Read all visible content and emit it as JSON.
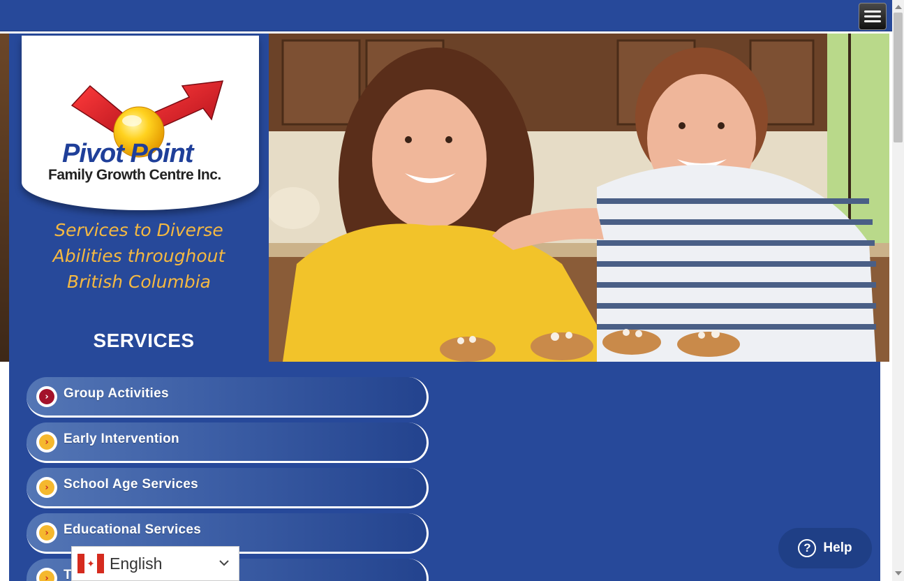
{
  "header": {
    "menu_icon": "hamburger-menu-icon"
  },
  "logo": {
    "name": "Pivot Point",
    "subtitle": "Family Growth Centre Inc."
  },
  "tagline": {
    "line1": "Services to Diverse",
    "line2": "Abilities throughout",
    "line3": "British Columbia"
  },
  "services": {
    "title": "SERVICES",
    "items": [
      {
        "label": "Group Activities",
        "active": true
      },
      {
        "label": "Early Intervention",
        "active": false
      },
      {
        "label": "School Age Services",
        "active": false
      },
      {
        "label": "Educational Services",
        "active": false
      },
      {
        "label": "T",
        "active": false
      }
    ]
  },
  "language": {
    "selected": "English",
    "flag_icon": "canada-flag-icon"
  },
  "help": {
    "label": "Help",
    "icon": "question-circle-icon"
  },
  "colors": {
    "primary_blue": "#27499a",
    "tagline_gold": "#f5b942",
    "arrow_red": "#d01f2a",
    "active_dot": "#a3122b",
    "dot_gold": "#f5b82e"
  }
}
